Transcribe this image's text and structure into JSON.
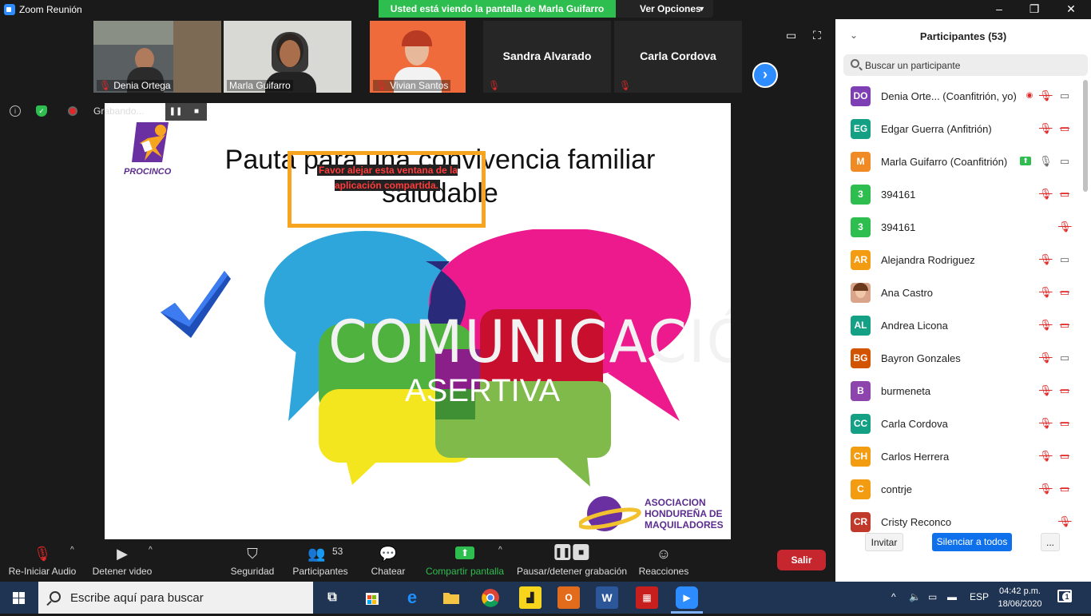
{
  "window": {
    "title": "Zoom Reunión",
    "sharing_banner": "Usted está viendo la pantalla de  Marla Guifarro",
    "view_options": "Ver Opciones"
  },
  "thumbnails": [
    {
      "name": "Denia Ortega",
      "muted": true
    },
    {
      "name": "Marla Guifarro",
      "muted": false
    },
    {
      "name": "Vivian Santos",
      "muted": true
    },
    {
      "name": "Sandra Alvarado",
      "muted": true
    },
    {
      "name": "Carla Cordova",
      "muted": true
    }
  ],
  "recording": {
    "status": "Grabando..."
  },
  "slide": {
    "title": "Pauta para una convivencia familiar saludable",
    "warning": "Favor alejar esta ventana de la aplicación compartida.",
    "logo_text": "PROCINCO",
    "headline": "COMUNICACIÓN",
    "subheadline": "ASERTIVA",
    "footer_logo_lines": [
      "ASOCIACION",
      "HONDUREÑA DE",
      "MAQUILADORES"
    ]
  },
  "participants_panel": {
    "title": "Participantes (53)",
    "search_placeholder": "Buscar un participante",
    "items": [
      {
        "initials": "DO",
        "name": "Denia Orte...  (Coanfitrión, yo)",
        "color": "#7e3fb5",
        "icons": [
          "rec",
          "mute",
          "cam"
        ]
      },
      {
        "initials": "EG",
        "name": "Edgar Guerra (Anfitrión)",
        "color": "#14a085",
        "icons": [
          "mute",
          "camoff"
        ]
      },
      {
        "initials": "M",
        "name": "Marla Guifarro (Coanfitrión)",
        "color": "#f08a24",
        "icons": [
          "share",
          "mic",
          "cam"
        ]
      },
      {
        "initials": "3",
        "name": "394161",
        "color": "#2ebd4f",
        "icons": [
          "mute",
          "camoff"
        ]
      },
      {
        "initials": "3",
        "name": "394161",
        "color": "#2ebd4f",
        "icons": [
          "mute"
        ]
      },
      {
        "initials": "AR",
        "name": "Alejandra Rodriguez",
        "color": "#f39c12",
        "icons": [
          "mute",
          "cam"
        ]
      },
      {
        "initials": "",
        "name": "Ana Castro",
        "color": "photo",
        "icons": [
          "mute",
          "camoff"
        ]
      },
      {
        "initials": "AL",
        "name": "Andrea Licona",
        "color": "#14a085",
        "icons": [
          "mute",
          "camoff"
        ]
      },
      {
        "initials": "BG",
        "name": "Bayron Gonzales",
        "color": "#d35400",
        "icons": [
          "mute",
          "cam"
        ]
      },
      {
        "initials": "B",
        "name": "burmeneta",
        "color": "#8e44ad",
        "icons": [
          "mute",
          "camoff"
        ]
      },
      {
        "initials": "CC",
        "name": "Carla Cordova",
        "color": "#14a085",
        "icons": [
          "mute",
          "camoff"
        ]
      },
      {
        "initials": "CH",
        "name": "Carlos Herrera",
        "color": "#f39c12",
        "icons": [
          "mute",
          "camoff"
        ]
      },
      {
        "initials": "C",
        "name": "contrje",
        "color": "#f39c12",
        "icons": [
          "mute",
          "camoff"
        ]
      },
      {
        "initials": "CR",
        "name": "Cristy Reconco",
        "color": "#c0392b",
        "icons": [
          "mute"
        ]
      }
    ],
    "invite_label": "Invitar",
    "mute_all_label": "Silenciar a todos",
    "more_label": "..."
  },
  "toolbar": {
    "audio_label": "Re-Iniciar Audio",
    "video_label": "Detener video",
    "security_label": "Seguridad",
    "participants_label": "Participantes",
    "participants_count": "53",
    "chat_label": "Chatear",
    "share_label": "Compartir pantalla",
    "record_label": "Pausar/detener grabación",
    "reactions_label": "Reacciones",
    "exit_label": "Salir"
  },
  "taskbar": {
    "search_placeholder": "Escribe aquí para buscar",
    "language": "ESP",
    "time": "04:42 p.m.",
    "date": "18/06/2020",
    "notifications": "1"
  },
  "colors": {
    "zoom_blue": "#2d8cff",
    "sharing_green": "#2ebd4f",
    "exit_red": "#c6262e",
    "mute_red": "#e02828"
  }
}
